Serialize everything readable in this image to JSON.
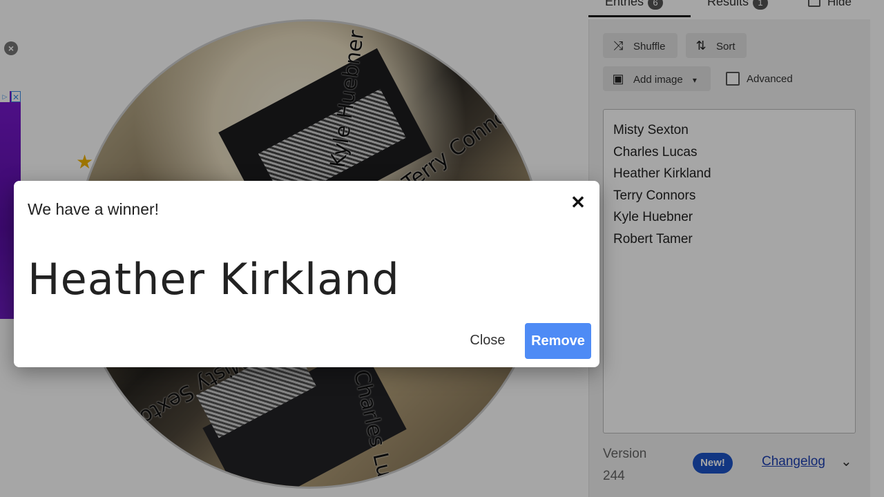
{
  "tabs": {
    "entries_label": "Entries",
    "entries_count": "6",
    "results_label": "Results",
    "results_count": "1",
    "hide_label": "Hide"
  },
  "toolbar": {
    "shuffle_label": "Shuffle",
    "sort_label": "Sort",
    "add_image_label": "Add image",
    "advanced_label": "Advanced"
  },
  "entries": [
    "Misty Sexton",
    "Charles Lucas",
    "Heather Kirkland",
    "Terry Connors",
    "Kyle Huebner",
    "Robert Tamer"
  ],
  "wheel": {
    "labels": [
      "Kyle Huebner",
      "Terry Connors",
      "Charles Lucas",
      "Misty Sexton"
    ]
  },
  "footer": {
    "version_label": "Version",
    "version_number": "244",
    "new_badge": "New!",
    "changelog_label": "Changelog"
  },
  "dialog": {
    "title": "We have a winner!",
    "winner": "Heather Kirkland",
    "close_label": "Close",
    "remove_label": "Remove"
  },
  "colors": {
    "remove_button": "#4e8bf5",
    "new_badge": "#1c54c8",
    "changelog_link": "#1c3fb2"
  }
}
